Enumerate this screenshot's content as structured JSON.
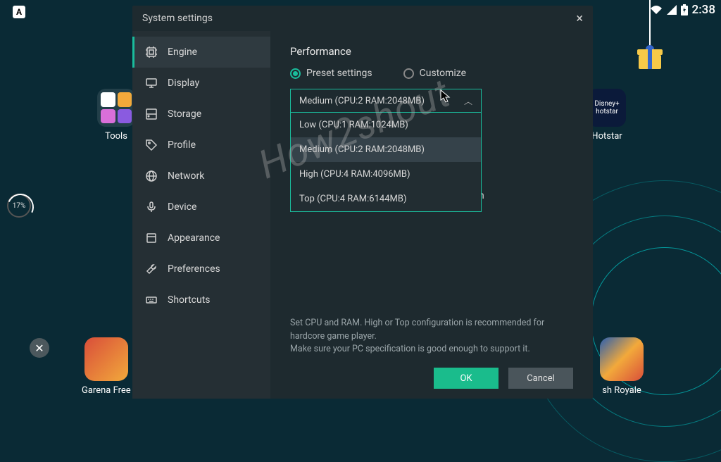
{
  "status_bar": {
    "time": "2:38"
  },
  "circ_pct": "17%",
  "desktop": {
    "tools_label": "Tools",
    "hotstar_label": "Hotstar",
    "garena_label": "Garena Free",
    "royale_label": "sh Royale"
  },
  "dialog": {
    "title": "System settings",
    "sidebar": {
      "items": [
        {
          "label": "Engine",
          "icon": "cpu"
        },
        {
          "label": "Display",
          "icon": "monitor"
        },
        {
          "label": "Storage",
          "icon": "drive"
        },
        {
          "label": "Profile",
          "icon": "tag"
        },
        {
          "label": "Network",
          "icon": "globe"
        },
        {
          "label": "Device",
          "icon": "mic"
        },
        {
          "label": "Appearance",
          "icon": "square"
        },
        {
          "label": "Preferences",
          "icon": "wrench"
        },
        {
          "label": "Shortcuts",
          "icon": "keyboard"
        }
      ]
    },
    "content": {
      "section_title": "Performance",
      "radio_preset": "Preset settings",
      "radio_custom": "Customize",
      "selected_option": "Medium (CPU:2 RAM:2048MB)",
      "options": [
        "Low (CPU:1 RAM:1024MB)",
        "Medium (CPU:2 RAM:2048MB)",
        "High (CPU:4 RAM:4096MB)",
        "Top (CPU:4 RAM:6144MB)"
      ],
      "stray_text": "tion",
      "footer_line1": "Set CPU and RAM. High or Top configuration is recommended for hardcore game player.",
      "footer_line2": "Make sure your PC specification is good enough to support it.",
      "ok_label": "OK",
      "cancel_label": "Cancel"
    }
  },
  "watermark": "How2shout"
}
